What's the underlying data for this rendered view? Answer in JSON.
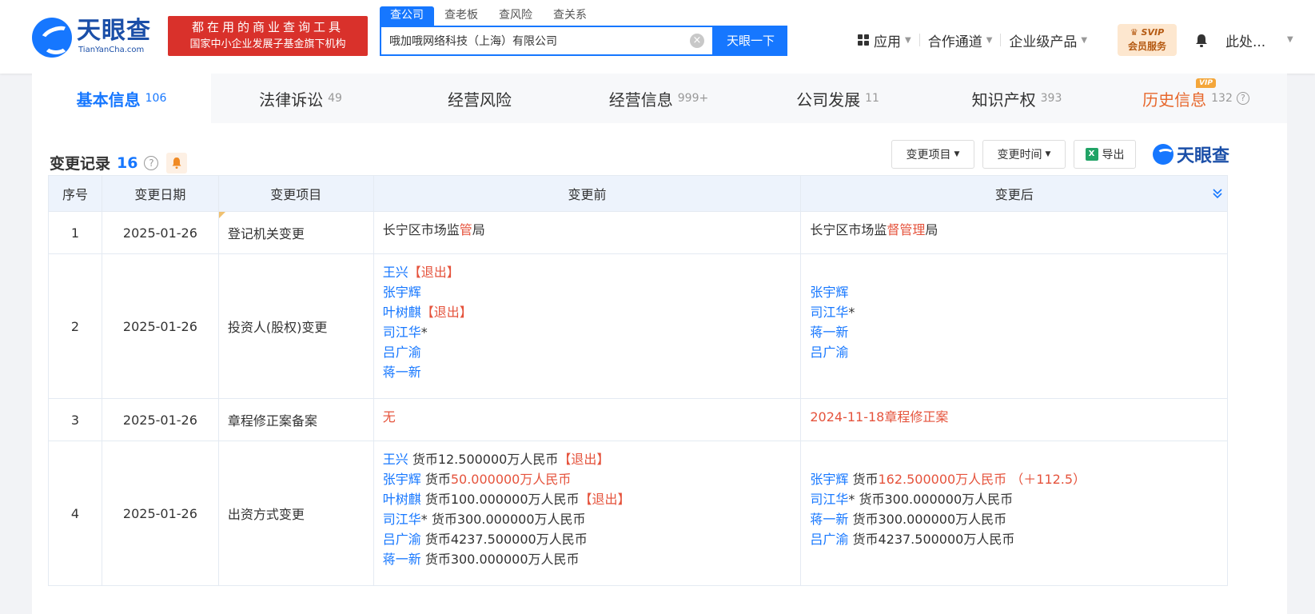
{
  "header": {
    "logo_text": "天眼查",
    "logo_sub": "TianYanCha.com",
    "slogan_line1": "都在用的商业查询工具",
    "slogan_line2": "国家中小企业发展子基金旗下机构",
    "search_tabs": [
      "查公司",
      "查老板",
      "查风险",
      "查关系"
    ],
    "search_value": "哦加哦网络科技（上海）有限公司",
    "search_button": "天眼一下",
    "nav": [
      "应用",
      "合作通道",
      "企业级产品"
    ],
    "svip_top": "SVIP",
    "svip_bottom": "会员服务",
    "user_name": "此处..."
  },
  "tabs": [
    {
      "label": "基本信息",
      "count": "106"
    },
    {
      "label": "法律诉讼",
      "count": "49"
    },
    {
      "label": "经营风险",
      "count": ""
    },
    {
      "label": "经营信息",
      "count": "999+"
    },
    {
      "label": "公司发展",
      "count": "11"
    },
    {
      "label": "知识产权",
      "count": "393"
    },
    {
      "label": "历史信息",
      "count": "132",
      "badge": "VIP"
    }
  ],
  "section": {
    "title": "变更记录",
    "count": "16",
    "help": "?",
    "filter_item": "变更项目",
    "filter_time": "变更时间",
    "export": "导出",
    "excel_glyph": "X",
    "brand": "天眼查"
  },
  "table": {
    "headers": [
      "序号",
      "变更日期",
      "变更项目",
      "变更前",
      "变更后"
    ],
    "rows": [
      {
        "no": "1",
        "date": "2025-01-26",
        "item": "登记机关变更",
        "before": [
          [
            {
              "t": "长宁区市场监",
              "c": "dark"
            },
            {
              "t": "管",
              "c": "red"
            },
            {
              "t": "局",
              "c": "dark"
            }
          ]
        ],
        "after": [
          [
            {
              "t": "长宁区市场监",
              "c": "dark"
            },
            {
              "t": "督管理",
              "c": "red"
            },
            {
              "t": "局",
              "c": "dark"
            }
          ]
        ]
      },
      {
        "no": "2",
        "date": "2025-01-26",
        "item": "投资人(股权)变更",
        "before": [
          [
            {
              "t": "王兴",
              "c": "blue"
            },
            {
              "t": "【退出】",
              "c": "red"
            }
          ],
          [
            {
              "t": "张宇辉",
              "c": "blue"
            }
          ],
          [
            {
              "t": "叶树麒",
              "c": "blue"
            },
            {
              "t": "【退出】",
              "c": "red"
            }
          ],
          [
            {
              "t": "司江华",
              "c": "blue"
            },
            {
              "t": "*",
              "c": "dark"
            }
          ],
          [
            {
              "t": "吕广渝",
              "c": "blue"
            }
          ],
          [
            {
              "t": "蒋一新",
              "c": "blue"
            }
          ]
        ],
        "after": [
          [
            {
              "t": "张宇辉",
              "c": "blue"
            }
          ],
          [
            {
              "t": "司江华",
              "c": "blue"
            },
            {
              "t": "*",
              "c": "dark"
            }
          ],
          [
            {
              "t": "蒋一新",
              "c": "blue"
            }
          ],
          [
            {
              "t": "吕广渝",
              "c": "blue"
            }
          ]
        ]
      },
      {
        "no": "3",
        "date": "2025-01-26",
        "item": "章程修正案备案",
        "before": [
          [
            {
              "t": "无",
              "c": "red"
            }
          ]
        ],
        "after": [
          [
            {
              "t": "2024-11-18章程修正案",
              "c": "red"
            }
          ]
        ]
      },
      {
        "no": "4",
        "date": "2025-01-26",
        "item": "出资方式变更",
        "before": [
          [
            {
              "t": "王兴",
              "c": "blue"
            },
            {
              "t": " 货币12.500000万人民币",
              "c": "dark"
            },
            {
              "t": "【退出】",
              "c": "red"
            }
          ],
          [
            {
              "t": "张宇辉",
              "c": "blue"
            },
            {
              "t": " 货币",
              "c": "dark"
            },
            {
              "t": "50.000000万人民币",
              "c": "red"
            }
          ],
          [
            {
              "t": "叶树麒",
              "c": "blue"
            },
            {
              "t": " 货币100.000000万人民币",
              "c": "dark"
            },
            {
              "t": "【退出】",
              "c": "red"
            }
          ],
          [
            {
              "t": "司江华",
              "c": "blue"
            },
            {
              "t": "* 货币300.000000万人民币",
              "c": "dark"
            }
          ],
          [
            {
              "t": "吕广渝",
              "c": "blue"
            },
            {
              "t": " 货币4237.500000万人民币",
              "c": "dark"
            }
          ],
          [
            {
              "t": "蒋一新",
              "c": "blue"
            },
            {
              "t": " 货币300.000000万人民币",
              "c": "dark"
            }
          ]
        ],
        "after": [
          [
            {
              "t": "张宇辉",
              "c": "blue"
            },
            {
              "t": " 货币",
              "c": "dark"
            },
            {
              "t": "162.500000万人民币 （＋112.5）",
              "c": "red"
            }
          ],
          [
            {
              "t": "司江华",
              "c": "blue"
            },
            {
              "t": "* 货币300.000000万人民币",
              "c": "dark"
            }
          ],
          [
            {
              "t": "蒋一新",
              "c": "blue"
            },
            {
              "t": " 货币300.000000万人民币",
              "c": "dark"
            }
          ],
          [
            {
              "t": "吕广渝",
              "c": "blue"
            },
            {
              "t": " 货币4237.500000万人民币",
              "c": "dark"
            }
          ]
        ]
      }
    ]
  },
  "colors": {
    "brand_blue": "#1677ff",
    "red": "#e5533c",
    "slogan_red": "#d9312b"
  }
}
